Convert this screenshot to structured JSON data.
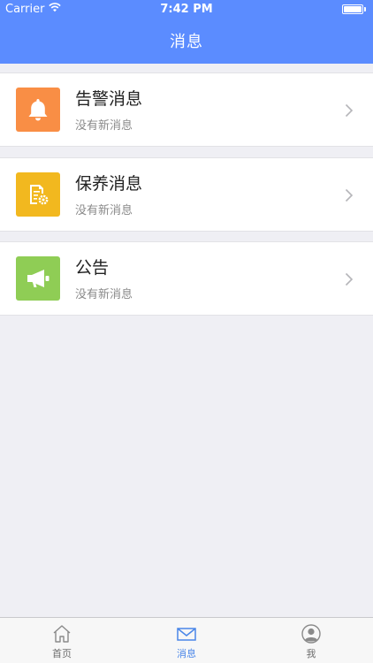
{
  "status_bar": {
    "carrier": "Carrier",
    "time": "7:42 PM",
    "wifi_icon": "wifi-icon",
    "battery_icon": "battery-icon"
  },
  "nav": {
    "title": "消息",
    "background": "#5b8cff"
  },
  "message_rows": [
    {
      "title": "告警消息",
      "subtitle": "没有新消息",
      "icon": "bell-icon",
      "icon_color": "#f98e45"
    },
    {
      "title": "保养消息",
      "subtitle": "没有新消息",
      "icon": "maintenance-doc-icon",
      "icon_color": "#f2b81f"
    },
    {
      "title": "公告",
      "subtitle": "没有新消息",
      "icon": "megaphone-icon",
      "icon_color": "#8fcd55"
    }
  ],
  "tabbar": {
    "items": [
      {
        "label": "首页",
        "icon": "home-icon",
        "active": false
      },
      {
        "label": "消息",
        "icon": "mail-icon",
        "active": true
      },
      {
        "label": "我",
        "icon": "profile-icon",
        "active": false
      }
    ],
    "active_color": "#4a86e8"
  }
}
